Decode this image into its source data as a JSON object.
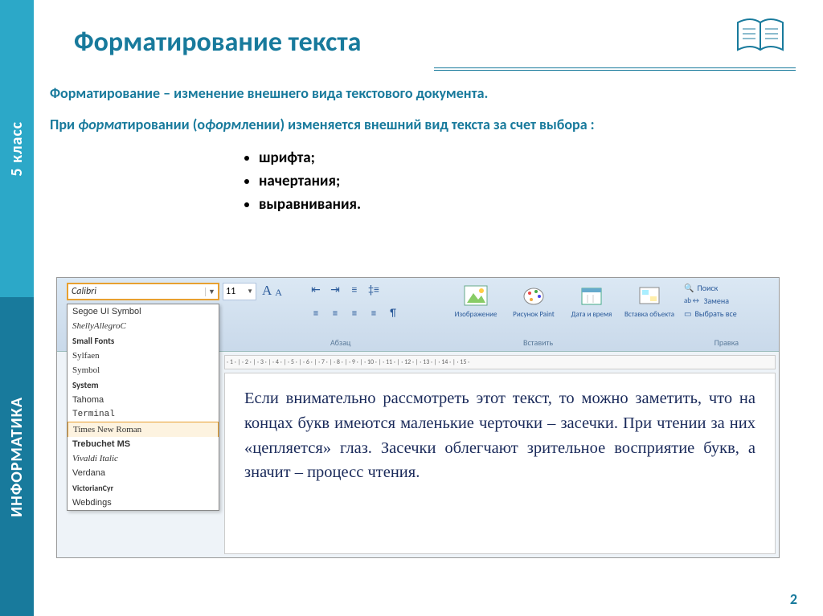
{
  "sidebar": {
    "top_label": "5 класс",
    "bottom_label": "ИНФОРМАТИКА"
  },
  "title": "Форматирование текста",
  "definition": "Форматирование – изменение внешнего вида текстового документа.",
  "paragraph": {
    "prefix": "При ",
    "italic1": "форма",
    "mid1": "тировании (о",
    "italic2": "форм",
    "mid2": "лении) изменяется внешний вид текста за счет выбора :"
  },
  "bullets": [
    "шрифта;",
    "начертания;",
    "выравнивания."
  ],
  "page_number": "2",
  "word": {
    "font_selected": "Calibri",
    "font_size": "11",
    "fonts": [
      {
        "label": "Segoe UI Symbol",
        "cls": "fl-segoe"
      },
      {
        "label": "ShellyAllegroC",
        "cls": "fl-script"
      },
      {
        "label": "Small Fonts",
        "cls": "fl-bold"
      },
      {
        "label": "Sylfaen",
        "cls": "fl-sylfaen"
      },
      {
        "label": "Symbol",
        "cls": "fl-symbol"
      },
      {
        "label": "System",
        "cls": "fl-bold"
      },
      {
        "label": "Tahoma",
        "cls": "fl-tahoma"
      },
      {
        "label": "Terminal",
        "cls": "fl-terminal"
      },
      {
        "label": "Times New Roman",
        "cls": "fl-times"
      },
      {
        "label": "Trebuchet MS",
        "cls": "fl-trebuchet"
      },
      {
        "label": "Vivaldi Italic",
        "cls": "fl-script"
      },
      {
        "label": "Verdana",
        "cls": "fl-verdana"
      },
      {
        "label": "VictorianCyr",
        "cls": "fl-bold"
      },
      {
        "label": "Webdings",
        "cls": "fl-webdings"
      }
    ],
    "group_labels": {
      "paragraph": "Абзац",
      "insert": "Вставить",
      "edit": "Правка"
    },
    "big_buttons": [
      "Изображение",
      "Рисунок Paint",
      "Дата и время",
      "Вставка объекта"
    ],
    "edit_items": [
      "Поиск",
      "Замена",
      "Выбрать все"
    ],
    "ruler_text": "· 1 · | · 2 · | · 3 · | · 4 · | · 5 · | · 6 · | · 7 · | · 8 · | · 9 · | · 10 · | · 11 · | · 12 · | · 13 · | · 14 · | · 15 ·",
    "doc_paragraph": "Если внимательно рассмотреть этот текст, то можно заметить, что на концах букв имеются маленькие черточки – засечки. При чтении за них «цепляется» глаз. Засечки облегчают зрительное восприятие букв, а значит – процесс чтения."
  }
}
